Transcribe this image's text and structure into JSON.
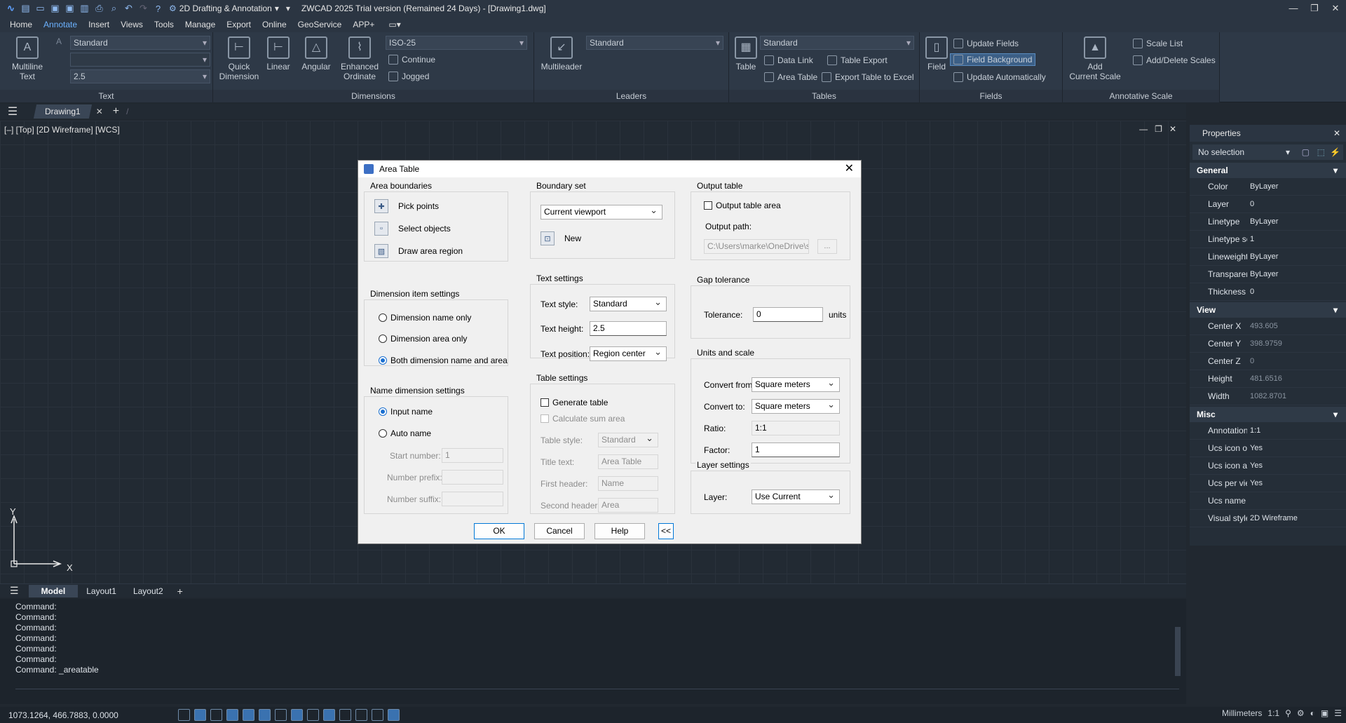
{
  "titlebar": {
    "workspace": "2D Drafting & Annotation",
    "title": "ZWCAD 2025 Trial version (Remained 24 Days) - [Drawing1.dwg]"
  },
  "menu": [
    "Home",
    "Annotate",
    "Insert",
    "Views",
    "Tools",
    "Manage",
    "Export",
    "Online",
    "GeoService",
    "APP+"
  ],
  "ribbon": {
    "text": {
      "multiline": "Multiline\nText",
      "style": "Standard",
      "height": "2.5",
      "title": "Text"
    },
    "dimensions": {
      "quick": "Quick\nDimension",
      "linear": "Linear",
      "angular": "Angular",
      "enhanced": "Enhanced\nOrdinate",
      "style": "ISO-25",
      "continue": "Continue",
      "jogged": "Jogged",
      "title": "Dimensions"
    },
    "leaders": {
      "multileader": "Multileader",
      "style": "Standard",
      "title": "Leaders"
    },
    "tables": {
      "table": "Table",
      "style": "Standard",
      "data_link": "Data Link",
      "table_export": "Table Export",
      "area_table": "Area Table",
      "export_excel": "Export Table to Excel",
      "title": "Tables"
    },
    "fields": {
      "field": "Field",
      "update": "Update Fields",
      "background": "Field Background",
      "auto": "Update Automatically",
      "title": "Fields"
    },
    "scale": {
      "add": "Add\nCurrent Scale",
      "list": "Scale List",
      "adddel": "Add/Delete Scales",
      "title": "Annotative Scale"
    }
  },
  "tabs": {
    "doc": "Drawing1"
  },
  "viewport": {
    "label": "[–] [Top] [2D Wireframe] [WCS]",
    "x": "X",
    "y": "Y"
  },
  "layouts": [
    "Model",
    "Layout1",
    "Layout2"
  ],
  "command_lines": [
    "Command:",
    "Command:",
    "Command:",
    "Command:",
    "Command:",
    "Command:",
    "Command: _areatable"
  ],
  "status": {
    "coords": "1073.1264, 466.7883, 0.0000",
    "units": "Millimeters",
    "scale": "1:1"
  },
  "properties": {
    "title": "Properties",
    "selection": "No selection",
    "general_title": "General",
    "general": [
      [
        "Color",
        "ByLayer"
      ],
      [
        "Layer",
        "0"
      ],
      [
        "Linetype",
        "ByLayer"
      ],
      [
        "Linetype scale",
        "1"
      ],
      [
        "Lineweight",
        "ByLayer"
      ],
      [
        "Transparency",
        "ByLayer"
      ],
      [
        "Thickness",
        "0"
      ]
    ],
    "view_title": "View",
    "view": [
      [
        "Center X",
        "493.605"
      ],
      [
        "Center Y",
        "398.9759"
      ],
      [
        "Center Z",
        "0"
      ],
      [
        "Height",
        "481.6516"
      ],
      [
        "Width",
        "1082.8701"
      ]
    ],
    "misc_title": "Misc",
    "misc": [
      [
        "Annotation ...",
        "1:1"
      ],
      [
        "Ucs icon on",
        "Yes"
      ],
      [
        "Ucs icon at ...",
        "Yes"
      ],
      [
        "Ucs per view...",
        "Yes"
      ],
      [
        "Ucs name",
        ""
      ],
      [
        "Visual style",
        "2D Wireframe"
      ]
    ]
  },
  "dialog": {
    "title": "Area Table",
    "area_boundaries": {
      "title": "Area boundaries",
      "pick": "Pick points",
      "select": "Select objects",
      "draw": "Draw area region"
    },
    "dim_item": {
      "title": "Dimension item settings",
      "opt1": "Dimension name only",
      "opt2": "Dimension area only",
      "opt3": "Both dimension name and area"
    },
    "name_dim": {
      "title": "Name dimension settings",
      "input": "Input name",
      "auto": "Auto name",
      "start_label": "Start number:",
      "start_value": "1",
      "prefix_label": "Number prefix:",
      "suffix_label": "Number suffix:"
    },
    "boundary": {
      "title": "Boundary set",
      "value": "Current viewport",
      "new": "New"
    },
    "text": {
      "title": "Text settings",
      "style_label": "Text style:",
      "style_value": "Standard",
      "height_label": "Text height:",
      "height_value": "2.5",
      "pos_label": "Text position:",
      "pos_value": "Region center"
    },
    "table": {
      "title": "Table settings",
      "generate": "Generate table",
      "sum": "Calculate sum area",
      "style_label": "Table style:",
      "style_value": "Standard",
      "title_label": "Title text:",
      "title_value": "Area Table",
      "first_label": "First header:",
      "first_value": "Name",
      "second_label": "Second header:",
      "second_value": "Area"
    },
    "output": {
      "title": "Output table",
      "check": "Output table area",
      "path_label": "Output path:",
      "path_value": "C:\\Users\\marke\\OneDrive\\sar",
      "browse": "..."
    },
    "gap": {
      "title": "Gap tolerance",
      "label": "Tolerance:",
      "value": "0",
      "unit": "units"
    },
    "units": {
      "title": "Units and scale",
      "from_label": "Convert from:",
      "from_value": "Square meters",
      "to_label": "Convert to:",
      "to_value": "Square meters",
      "ratio_label": "Ratio:",
      "ratio_value": "1:1",
      "factor_label": "Factor:",
      "factor_value": "1"
    },
    "layer": {
      "title": "Layer settings",
      "label": "Layer:",
      "value": "Use Current"
    },
    "buttons": {
      "ok": "OK",
      "cancel": "Cancel",
      "help": "Help",
      "collapse": "<<"
    }
  }
}
